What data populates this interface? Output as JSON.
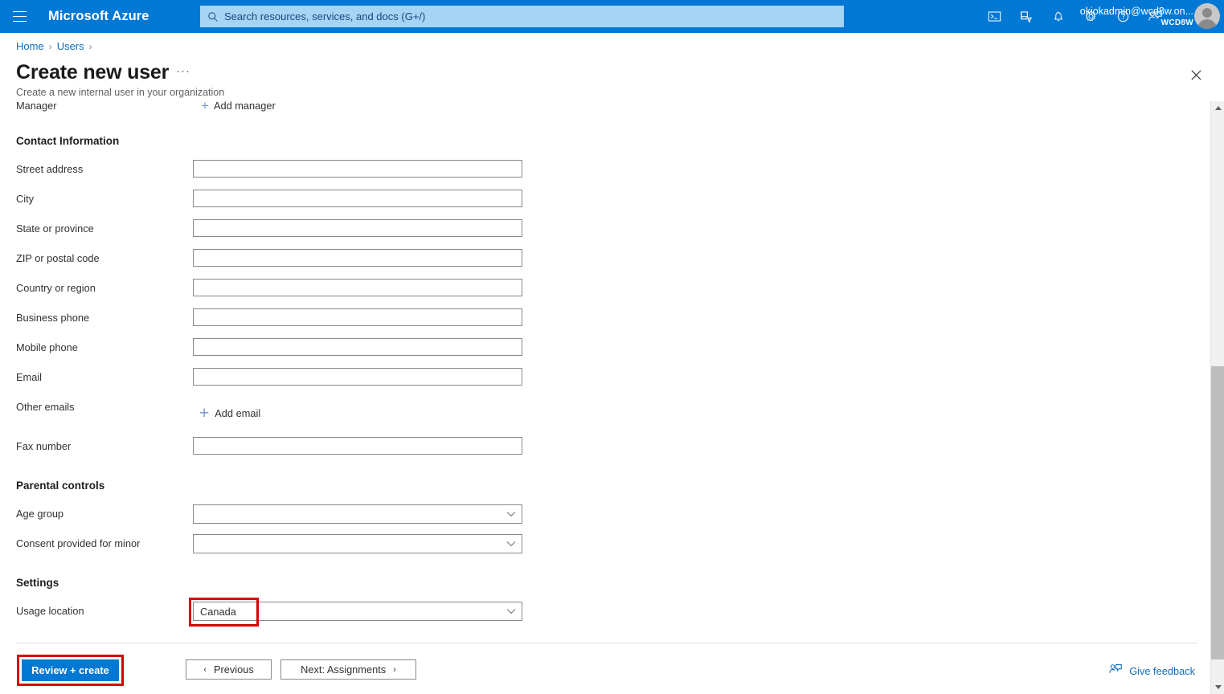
{
  "topbar": {
    "menu_icon": "hamburger-icon",
    "brand": "Microsoft Azure",
    "search_placeholder": "Search resources, services, and docs (G+/)",
    "search_icon": "search-icon",
    "icons": [
      {
        "name": "cloud-shell-icon",
        "title": "Cloud Shell"
      },
      {
        "name": "directories-subscriptions-icon",
        "title": "Directories + subscriptions"
      },
      {
        "name": "notifications-bell-icon",
        "title": "Notifications"
      },
      {
        "name": "settings-gear-icon",
        "title": "Settings"
      },
      {
        "name": "help-question-icon",
        "title": "Help"
      },
      {
        "name": "feedback-person-icon",
        "title": "Feedback"
      }
    ],
    "account_name": "okiokadmin@wcd8w.on...",
    "account_tenant": "WCD8W",
    "avatar_icon": "user-avatar-icon",
    "accent_color": "#0078d4",
    "search_bg": "#a5d4f5"
  },
  "blade": {
    "breadcrumb": [
      {
        "label": "Home"
      },
      {
        "label": "Users"
      }
    ],
    "breadcrumb_separator": "›",
    "title": "Create new user",
    "title_ellipsis": "···",
    "subtitle": "Create a new internal user in your organization",
    "close_icon": "close-icon"
  },
  "form": {
    "manager": {
      "label": "Manager",
      "add_label": "Add manager",
      "add_icon": "plus-icon"
    },
    "contact_information": {
      "heading": "Contact Information",
      "fields": [
        {
          "label": "Street address",
          "value": "",
          "placeholder": ""
        },
        {
          "label": "City",
          "value": "",
          "placeholder": ""
        },
        {
          "label": "State or province",
          "value": "",
          "placeholder": ""
        },
        {
          "label": "ZIP or postal code",
          "value": "",
          "placeholder": ""
        },
        {
          "label": "Country or region",
          "value": "",
          "placeholder": ""
        },
        {
          "label": "Business phone",
          "value": "",
          "placeholder": ""
        },
        {
          "label": "Mobile phone",
          "value": "",
          "placeholder": ""
        },
        {
          "label": "Email",
          "value": "",
          "placeholder": ""
        }
      ],
      "other_emails": {
        "label": "Other emails",
        "add_label": "Add email",
        "add_icon": "plus-icon"
      },
      "fax": {
        "label": "Fax number",
        "value": "",
        "placeholder": ""
      }
    },
    "parental_controls": {
      "heading": "Parental controls",
      "fields": [
        {
          "label": "Age group",
          "value": "",
          "chevron": "chevron-down-icon"
        },
        {
          "label": "Consent provided for minor",
          "value": "",
          "chevron": "chevron-down-icon"
        }
      ]
    },
    "settings": {
      "heading": "Settings",
      "usage_location": {
        "label": "Usage location",
        "value": "Canada",
        "chevron": "chevron-down-icon",
        "highlighted": true
      }
    }
  },
  "footer": {
    "review_create": "Review + create",
    "previous": "Previous",
    "previous_chevron": "‹",
    "next": "Next: Assignments",
    "next_chevron": "›",
    "give_feedback": "Give feedback",
    "give_feedback_icon": "feedback-person-icon"
  },
  "annotations": {
    "color": "#d60000",
    "boxes": [
      {
        "target": "usage-location-value"
      },
      {
        "target": "review-create-button"
      }
    ]
  },
  "scrollbar": {
    "up_icon": "scroll-up-arrow-icon",
    "down_icon": "scroll-down-arrow-icon",
    "thumb": "scrollbar-thumb"
  }
}
